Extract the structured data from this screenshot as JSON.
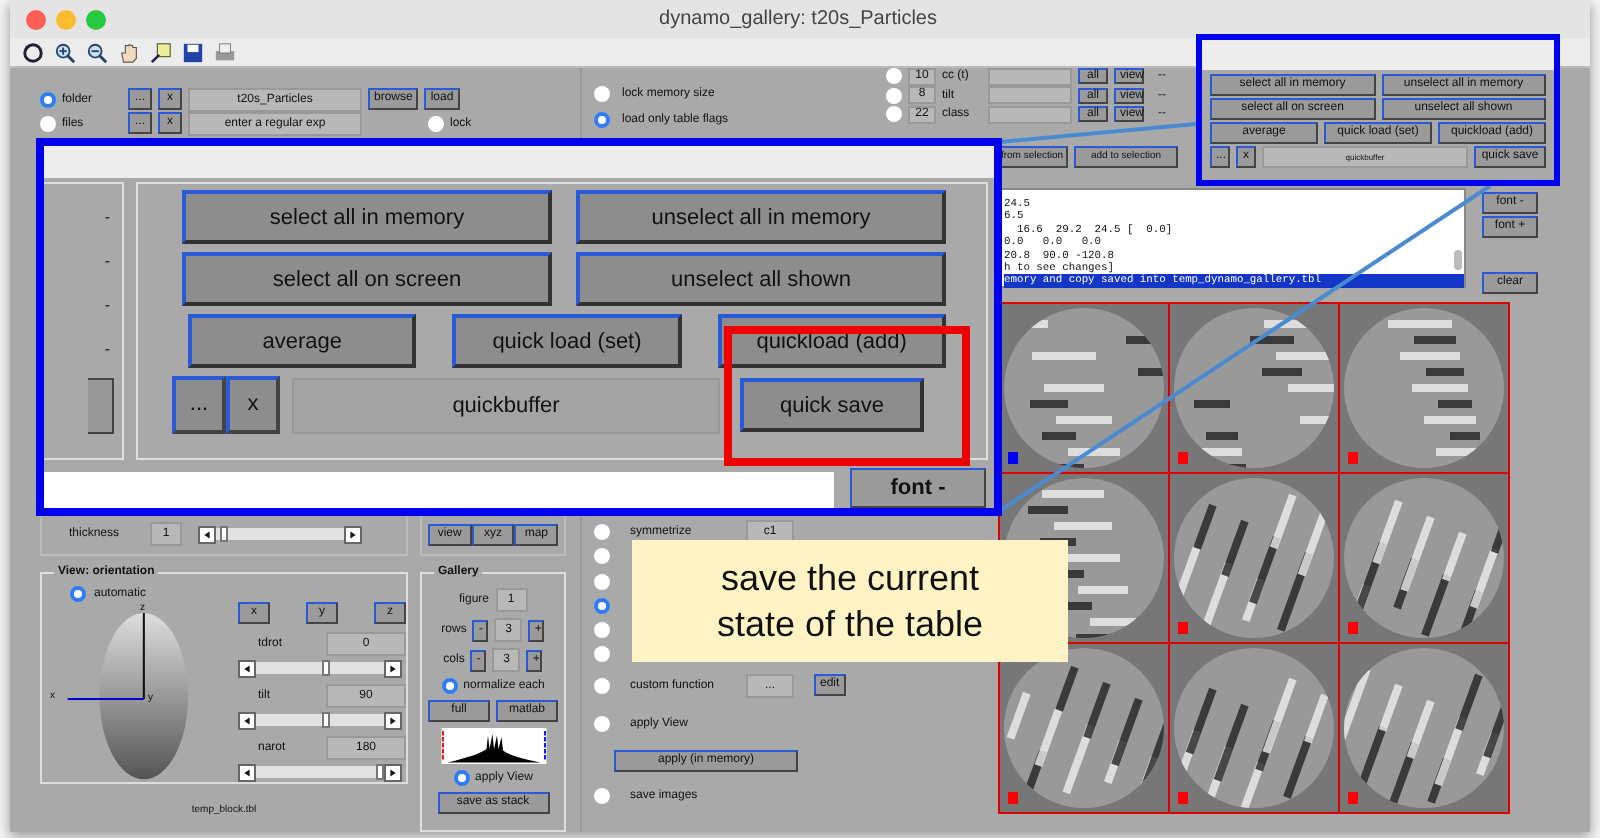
{
  "window": {
    "title": "dynamo_gallery: t20s_Particles"
  },
  "source": {
    "rows": [
      {
        "label": "folder",
        "selected": true,
        "small_buttons": [
          "...",
          "x"
        ],
        "value": "t20s_Particles",
        "button": "browse"
      },
      {
        "label": "files",
        "selected": false,
        "small_buttons": [
          "...",
          "x"
        ],
        "value": "enter a regular exp"
      }
    ],
    "load_button": "load",
    "lock": {
      "label": "lock",
      "selected": false
    }
  },
  "memory_options": [
    {
      "label": "lock memory size",
      "selected": false
    },
    {
      "label": "load only table flags",
      "selected": true
    }
  ],
  "filters": {
    "rows": [
      {
        "selected": false,
        "value": "10",
        "label": "cc (t)",
        "buttons": [
          "all",
          "view"
        ],
        "dash": "--"
      },
      {
        "selected": false,
        "value": "8",
        "label": "tilt",
        "buttons": [
          "all",
          "view"
        ],
        "dash": "--"
      },
      {
        "selected": false,
        "value": "22",
        "label": "class",
        "buttons": [
          "all",
          "view"
        ],
        "dash": "--"
      }
    ],
    "selection_buttons": [
      "from selection",
      "add to selection"
    ]
  },
  "log": {
    "lines": [
      {
        "text": "24.5",
        "selected": false
      },
      {
        "text": "6.5",
        "selected": false
      },
      {
        "text": "  16.6  29.2  24.5 [  0.0]",
        "selected": false
      },
      {
        "text": "0.0   0.0   0.0",
        "selected": false
      },
      {
        "text": "20.8  90.0 -120.8",
        "selected": false
      },
      {
        "text": "h to see changes]",
        "selected": false
      },
      {
        "text": "emory and copy saved into temp_dynamo_gallery.tbl",
        "selected": true
      }
    ],
    "buttons": [
      "font -",
      "font +",
      "clear"
    ]
  },
  "particles": [
    {
      "kind": "picture",
      "color": "#0000ff"
    },
    {
      "kind": "picture",
      "color": "#ff0000"
    },
    {
      "kind": "picture",
      "color": "#ff0000"
    },
    {
      "kind": "picture"
    },
    {
      "kind": "picture",
      "color": "#ff0000"
    },
    {
      "kind": "picture",
      "color": "#ff0000"
    },
    {
      "kind": "picture",
      "color": "#ff0000"
    },
    {
      "kind": "picture",
      "color": "#ff0000"
    },
    {
      "kind": "picture",
      "color": "#ff0000"
    }
  ],
  "thickness": {
    "label": "thickness",
    "value": "1",
    "level": 0.04
  },
  "view_buttons": [
    "view",
    "xyz",
    "map"
  ],
  "orientation": {
    "title": "View: orientation",
    "automatic": {
      "label": "automatic",
      "selected": true
    },
    "axes": [
      "z",
      "x",
      "y"
    ],
    "axis_buttons": [
      "x",
      "y",
      "z"
    ],
    "angles": [
      {
        "label": "tdrot",
        "value": "0",
        "level": 0.55
      },
      {
        "label": "tilt",
        "value": "90",
        "level": 0.55
      },
      {
        "label": "narot",
        "value": "180",
        "level": 1
      }
    ]
  },
  "gallery": {
    "title": "Gallery",
    "figure": {
      "label": "figure",
      "value": "1"
    },
    "counters": [
      {
        "label": "rows",
        "value": "3",
        "minus": "-",
        "plus": "+"
      },
      {
        "label": "cols",
        "value": "3",
        "minus": "-",
        "plus": "+"
      }
    ],
    "normalize": {
      "label": "normalize each",
      "selected": true
    },
    "buttons": [
      "full",
      "matlab"
    ],
    "apply_view": {
      "label": "apply View",
      "selected": true
    },
    "save_button": "save as stack"
  },
  "operations": [
    {
      "kind": "field",
      "label": "symmetrize",
      "selected": false,
      "value": "c1"
    },
    {
      "kind": "hidden",
      "selected": false
    },
    {
      "kind": "hidden",
      "selected": false
    },
    {
      "kind": "hidden",
      "selected": true
    },
    {
      "kind": "hidden",
      "selected": false
    },
    {
      "kind": "hidden",
      "selected": false
    },
    {
      "kind": "custom",
      "label": "custom function",
      "selected": false,
      "value": "...",
      "button": "edit"
    },
    {
      "kind": "plain",
      "label": "apply View",
      "selected": false
    }
  ],
  "apply_button": "apply (in memory)",
  "save_images": {
    "label": "save images",
    "selected": false
  },
  "footer": "temp_block.tbl",
  "callout_large": {
    "left_marks": [
      "-",
      "-",
      "-",
      "-"
    ],
    "rows": [
      [
        "select all in memory",
        "unselect all in memory"
      ],
      [
        "select all on screen",
        "unselect all shown"
      ],
      [
        "average",
        "quick load (set)",
        "quickload (add)"
      ]
    ],
    "small_buttons": [
      "...",
      "x"
    ],
    "field": "quickbuffer",
    "save": "quick save",
    "font_button": "font -"
  },
  "callout_small": {
    "rows": [
      [
        "select all in memory",
        "unselect all in memory"
      ],
      [
        "select all on screen",
        "unselect all shown"
      ],
      [
        "average",
        "quick load (set)",
        "quickload (add)"
      ]
    ],
    "small_buttons": [
      "...",
      "x"
    ],
    "field": "quickbuffer",
    "save": "quick save"
  },
  "tooltip": {
    "lines": [
      "save the current",
      "state of the table"
    ]
  }
}
